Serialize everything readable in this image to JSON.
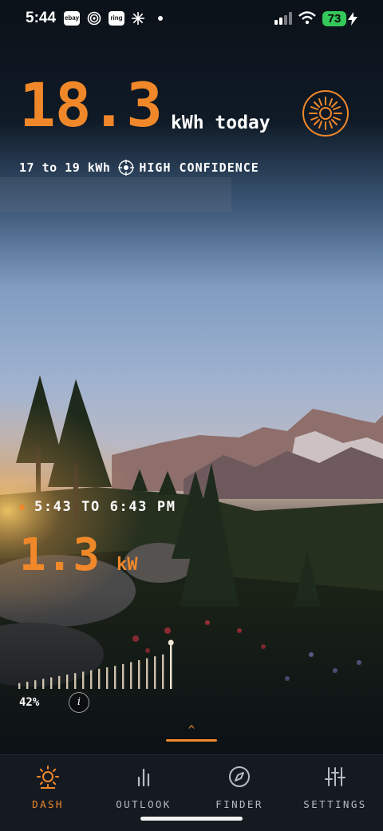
{
  "status_bar": {
    "time": "5:44",
    "notifications": [
      "ebay",
      "ring"
    ],
    "battery": "73",
    "colors": {
      "battery": "#34c759"
    }
  },
  "forecast": {
    "total_value": "18.3",
    "total_unit": "kWh today",
    "range": "17 to 19 kWh",
    "confidence": "HIGH CONFIDENCE"
  },
  "peak": {
    "window": "5:43 TO 6:43 PM",
    "power_value": "1.3",
    "power_unit": "kW",
    "percent": "42%",
    "info_label": "i",
    "bar_levels": [
      0.12,
      0.15,
      0.18,
      0.21,
      0.24,
      0.27,
      0.3,
      0.33,
      0.36,
      0.39,
      0.42,
      0.45,
      0.48,
      0.52,
      0.56,
      0.6,
      0.64,
      0.68,
      0.72,
      1.0
    ]
  },
  "tabs": [
    {
      "label": "DASH",
      "icon": "sun-icon",
      "active": true
    },
    {
      "label": "OUTLOOK",
      "icon": "bar-chart-icon",
      "active": false
    },
    {
      "label": "FINDER",
      "icon": "compass-icon",
      "active": false
    },
    {
      "label": "SETTINGS",
      "icon": "sliders-icon",
      "active": false
    }
  ],
  "theme": {
    "accent": "#f0882a",
    "tabbar_bg": "#151a21"
  }
}
